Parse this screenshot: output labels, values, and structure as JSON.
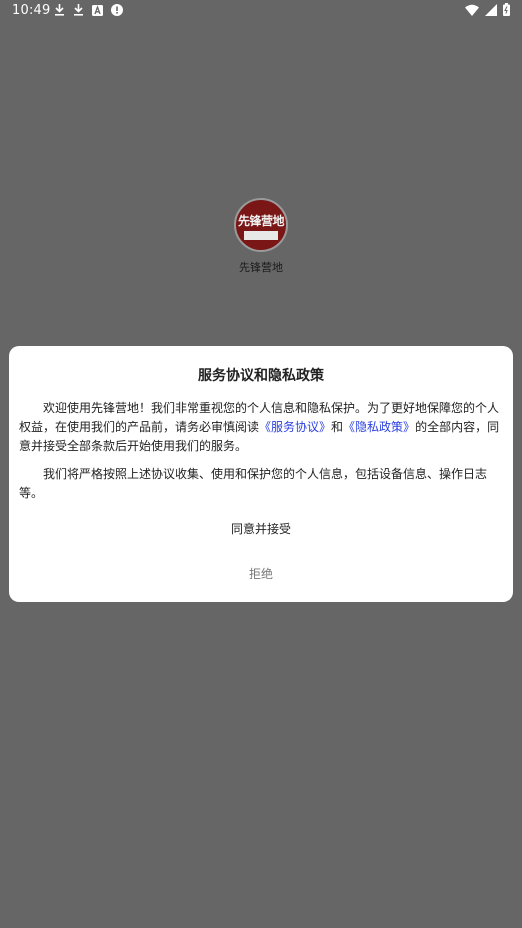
{
  "status_bar": {
    "time": "10:49",
    "left_icons": [
      "download-icon",
      "download-icon",
      "font-icon",
      "alert-icon"
    ],
    "right_icons": [
      "wifi-icon",
      "signal-icon",
      "battery-icon"
    ]
  },
  "app": {
    "logo_text": "先锋营地",
    "logo_subtext": "",
    "name": "先锋营地"
  },
  "dialog": {
    "title": "服务协议和隐私政策",
    "para1_text_a": "欢迎使用先锋营地！我们非常重视您的个人信息和隐私保护。为了更好地保障您的个人权益，在使用我们的产品前，请务必审慎阅读",
    "link_service": "《服务协议》",
    "and_text": "和",
    "link_privacy": "《隐私政策》",
    "para1_text_b": "的全部内容，同意并接受全部条款后开始使用我们的服务。",
    "para2_text": "我们将严格按照上述协议收集、使用和保护您的个人信息，包括设备信息、操作日志等。",
    "agree_label": "同意并接受",
    "reject_label": "拒绝",
    "link_color": "#2a3fe0"
  }
}
